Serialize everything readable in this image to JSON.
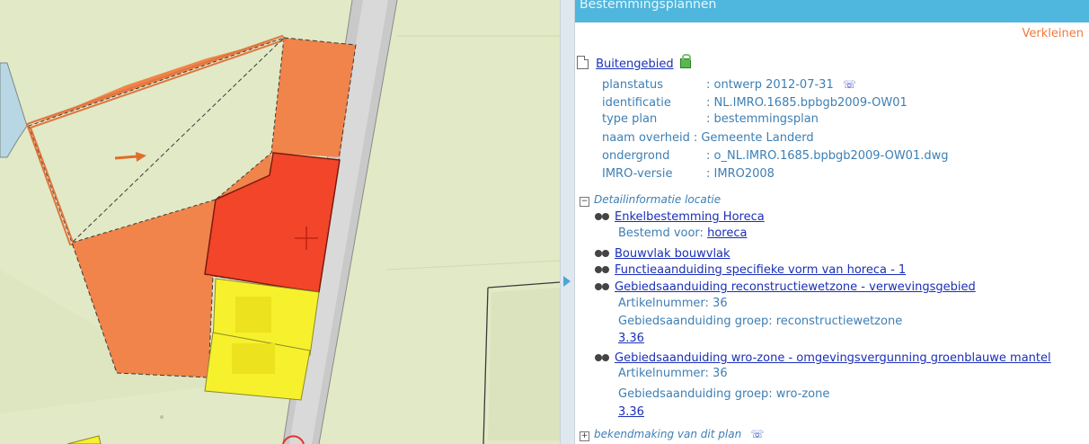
{
  "panel": {
    "title": "Bestemmingsplannen",
    "shrink_label": "Verkleinen"
  },
  "plan": {
    "name": "Buitengebied",
    "fields": [
      {
        "label": "planstatus",
        "value": ": ontwerp 2012-07-31"
      },
      {
        "label": "identificatie",
        "value": ": NL.IMRO.1685.bpbgb2009-OW01"
      },
      {
        "label": "type plan",
        "value": ": bestemmingsplan"
      },
      {
        "label": "naam overheid",
        "value": ": Gemeente Landerd"
      },
      {
        "label": "ondergrond",
        "value": ": o_NL.IMRO.1685.bpbgb2009-OW01.dwg"
      },
      {
        "label": "IMRO-versie",
        "value": ": IMRO2008"
      }
    ]
  },
  "detail": {
    "section_label": "Detailinformatie locatie",
    "items": [
      {
        "title": "Enkelbestemming Horeca",
        "sub_label": "Bestemd voor:",
        "sub_link": "horeca"
      },
      {
        "title": "Bouwvlak bouwvlak"
      },
      {
        "title": "Functieaanduiding specifieke vorm van horeca - 1"
      },
      {
        "title": "Gebiedsaanduiding reconstructiewetzone - verwevingsgebied",
        "article": "Artikelnummer: 36",
        "group": "Gebiedsaanduiding groep: reconstructiewetzone",
        "ref": "3.36"
      },
      {
        "title": "Gebiedsaanduiding wro-zone - omgevingsvergunning groenblauwe mantel",
        "article": "Artikelnummer: 36",
        "group": "Gebiedsaanduiding groep: wro-zone",
        "ref": "3.36"
      }
    ]
  },
  "footer_section": {
    "label": "bekendmaking van dit plan"
  },
  "icons": {
    "document": "document-icon",
    "lock": "lock-icon",
    "info": "info-icon",
    "collapse": "collapse-icon",
    "expand": "expand-icon",
    "binoculars": "binoculars-icon",
    "map_marker": "crosshair-icon",
    "map_arrow": "arrow-icon"
  },
  "colors": {
    "header": "#4fb6dd",
    "shrink": "#ee7a3c",
    "link": "#1a2fb8",
    "label": "#3d7fb4",
    "horeca": "#f0844a",
    "horeca_selected": "#f2452a",
    "yellow_zone": "#f6f12c",
    "map_background": "#e2e9c6"
  }
}
